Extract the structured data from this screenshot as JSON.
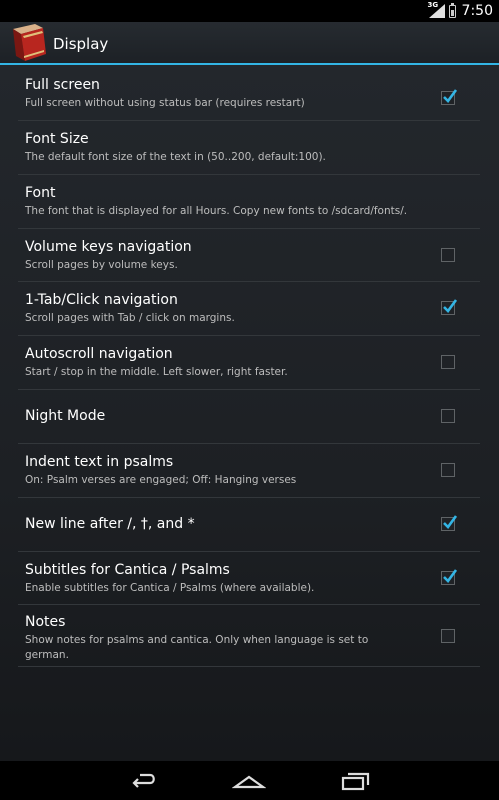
{
  "status_bar": {
    "network": "3G",
    "time": "7:50"
  },
  "action_bar": {
    "title": "Display",
    "icon": "book-icon"
  },
  "preferences": [
    {
      "title": "Full screen",
      "summary": "Full screen without using status bar (requires restart)",
      "checkbox": true,
      "checked": true
    },
    {
      "title": "Font Size",
      "summary": "The default font size of the text in  (50..200, default:100).",
      "checkbox": false
    },
    {
      "title": "Font",
      "summary": "The font that is displayed for all Hours. Copy new fonts to /sdcard/fonts/.",
      "checkbox": false
    },
    {
      "title": "Volume keys navigation",
      "summary": "Scroll pages by volume keys.",
      "checkbox": true,
      "checked": false
    },
    {
      "title": "1-Tab/Click navigation",
      "summary": "Scroll pages with Tab / click on margins.",
      "checkbox": true,
      "checked": true
    },
    {
      "title": "Autoscroll navigation",
      "summary": "Start / stop in the middle. Left slower, right faster.",
      "checkbox": true,
      "checked": false
    },
    {
      "title": "Night Mode",
      "summary": "",
      "checkbox": true,
      "checked": false
    },
    {
      "title": "Indent text in psalms",
      "summary": "On: Psalm verses are engaged; Off: Hanging verses",
      "checkbox": true,
      "checked": false
    },
    {
      "title": "New line after /, †, and *",
      "summary": "",
      "checkbox": true,
      "checked": true
    },
    {
      "title": "Subtitles for Cantica / Psalms",
      "summary": "Enable subtitles for Cantica / Psalms (where available).",
      "checkbox": true,
      "checked": true
    },
    {
      "title": "Notes",
      "summary": "Show notes for psalms and cantica. Only when language is set to german.",
      "checkbox": true,
      "checked": false
    }
  ],
  "nav_bar": {
    "back": "back-icon",
    "home": "home-icon",
    "recents": "recent-apps-icon"
  },
  "colors": {
    "accent": "#33b5e5",
    "background": "#1f2226",
    "text": "#ffffff",
    "summary": "#bdbdbd"
  }
}
